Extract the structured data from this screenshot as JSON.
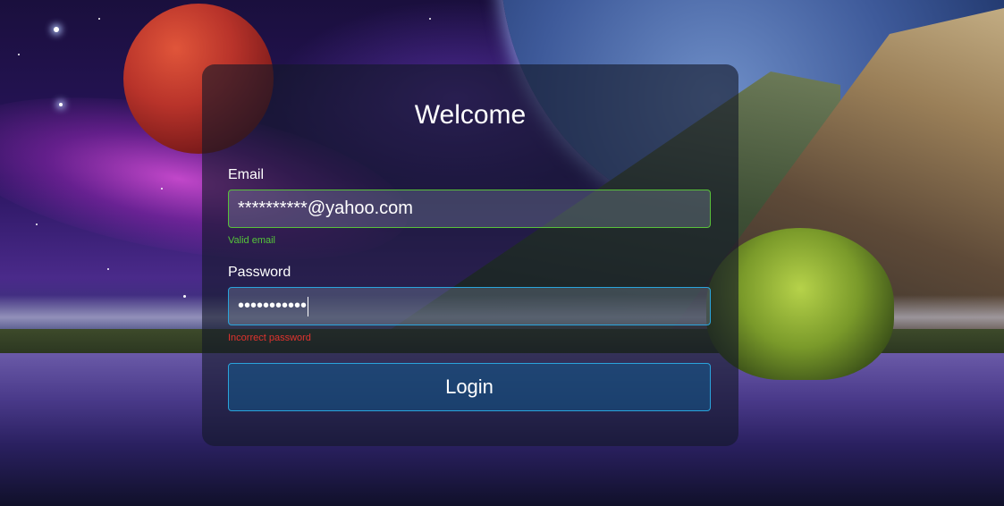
{
  "login": {
    "title": "Welcome",
    "email": {
      "label": "Email",
      "value": "**********@yahoo.com",
      "hint": "Valid email",
      "hint_color": "#55c43a"
    },
    "password": {
      "label": "Password",
      "value": "•••••••••••",
      "hint": "Incorrect password",
      "hint_color": "#e0332e"
    },
    "submit_label": "Login"
  },
  "colors": {
    "email_border": "#59c13a",
    "password_border": "#2aa4dc",
    "button_border": "#2aa4dc",
    "text": "#ffffff"
  }
}
